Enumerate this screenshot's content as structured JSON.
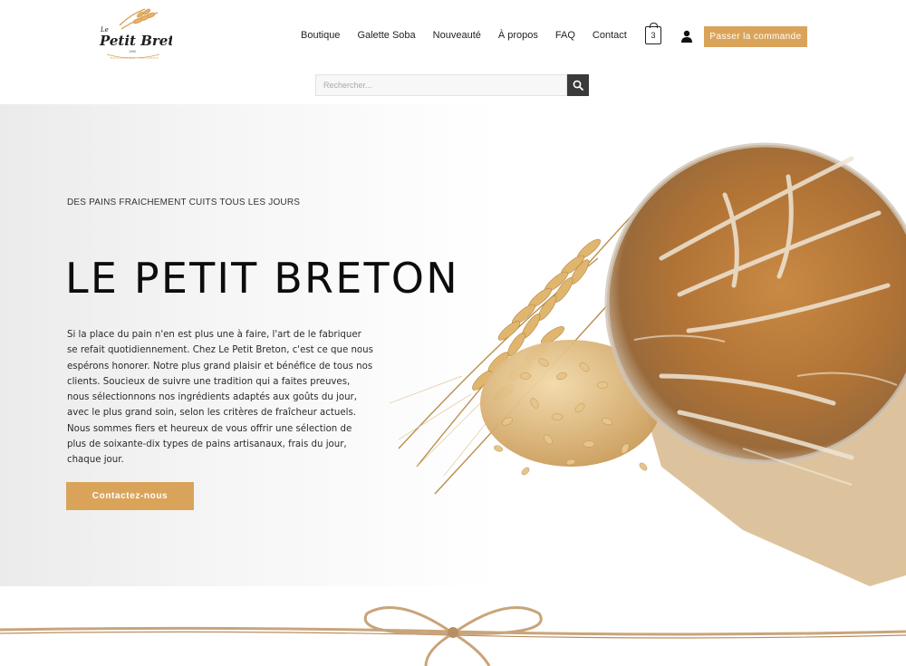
{
  "header": {
    "logo_alt": "Le Petit Breton",
    "nav": [
      "Boutique",
      "Galette Soba",
      "Nouveauté",
      "À propos",
      "FAQ",
      "Contact"
    ],
    "cart_count": "3",
    "order_button": "Passer la commande"
  },
  "search": {
    "placeholder": "Rechercher..."
  },
  "hero": {
    "eyebrow": "DES PAINS FRAICHEMENT CUITS TOUS LES JOURS",
    "title": "LE PETIT BRETON",
    "description": "Si la place du pain n'en est plus une à faire, l'art de le fabriquer se refait quotidiennement. Chez Le Petit Breton, c'est ce que nous espérons honorer. Notre plus grand plaisir et bénéfice de tous nos clients. Soucieux de suivre une tradition qui a faites preuves, nous sélectionnons nos ingrédients adaptés aux goûts du jour, avec le plus grand soin, selon les critères de fraîcheur actuels. Nous sommes fiers et heureux de vous offrir une sélection de plus de soixante-dix types de pains artisanaux, frais du jour, chaque jour.",
    "cta": "Contactez-nous"
  },
  "colors": {
    "accent": "#d9a45a",
    "dark": "#3a3a3a"
  }
}
